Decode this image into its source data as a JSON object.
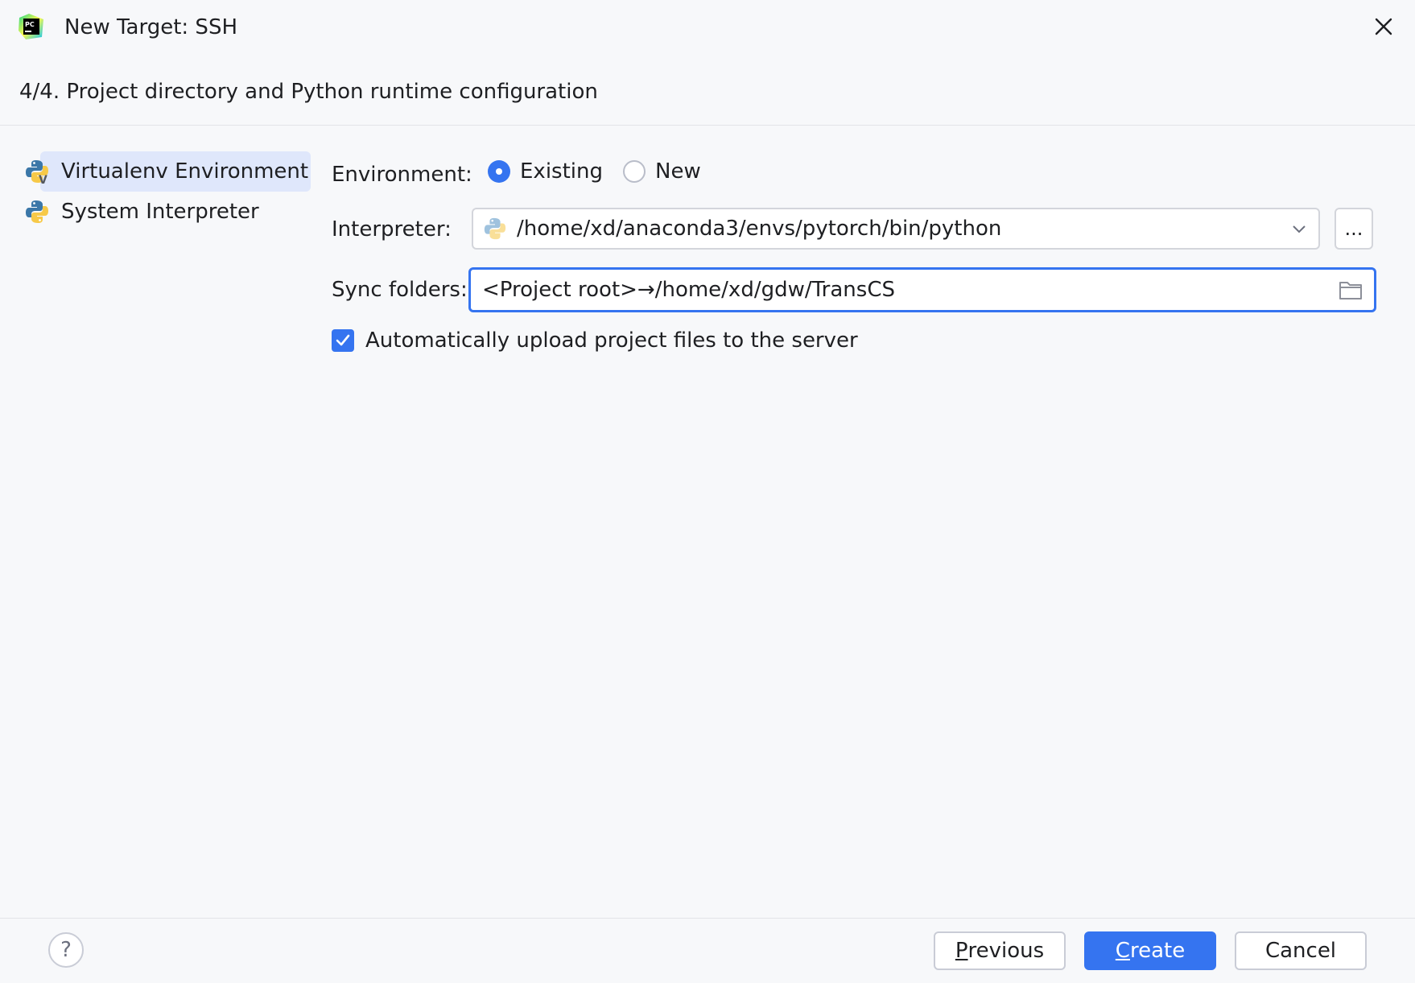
{
  "window": {
    "title": "New Target: SSH",
    "app_icon": "pycharm-logo-icon"
  },
  "step": {
    "header": "4/4. Project directory and Python runtime configuration"
  },
  "sidebar": {
    "items": [
      {
        "label": "Virtualenv Environment",
        "icon": "python-virtualenv-icon",
        "selected": true
      },
      {
        "label": "System Interpreter",
        "icon": "python-icon",
        "selected": false
      }
    ]
  },
  "form": {
    "environment": {
      "label": "Environment:",
      "options": [
        {
          "label": "Existing",
          "selected": true
        },
        {
          "label": "New",
          "selected": false
        }
      ]
    },
    "interpreter": {
      "label": "Interpreter:",
      "value": "/home/xd/anaconda3/envs/pytorch/bin/python",
      "browse_label": "..."
    },
    "sync_folders": {
      "label": "Sync folders:",
      "value": "<Project root>→/home/xd/gdw/TransCS"
    },
    "auto_upload": {
      "label": "Automatically upload project files to the server",
      "checked": true
    }
  },
  "footer": {
    "help_label": "?",
    "previous": {
      "mnemonic": "P",
      "rest": "revious"
    },
    "create": {
      "mnemonic": "C",
      "rest": "reate"
    },
    "cancel": "Cancel"
  },
  "colors": {
    "accent": "#3574f0",
    "background": "#f7f8fa",
    "selection": "#dfe7fb"
  }
}
